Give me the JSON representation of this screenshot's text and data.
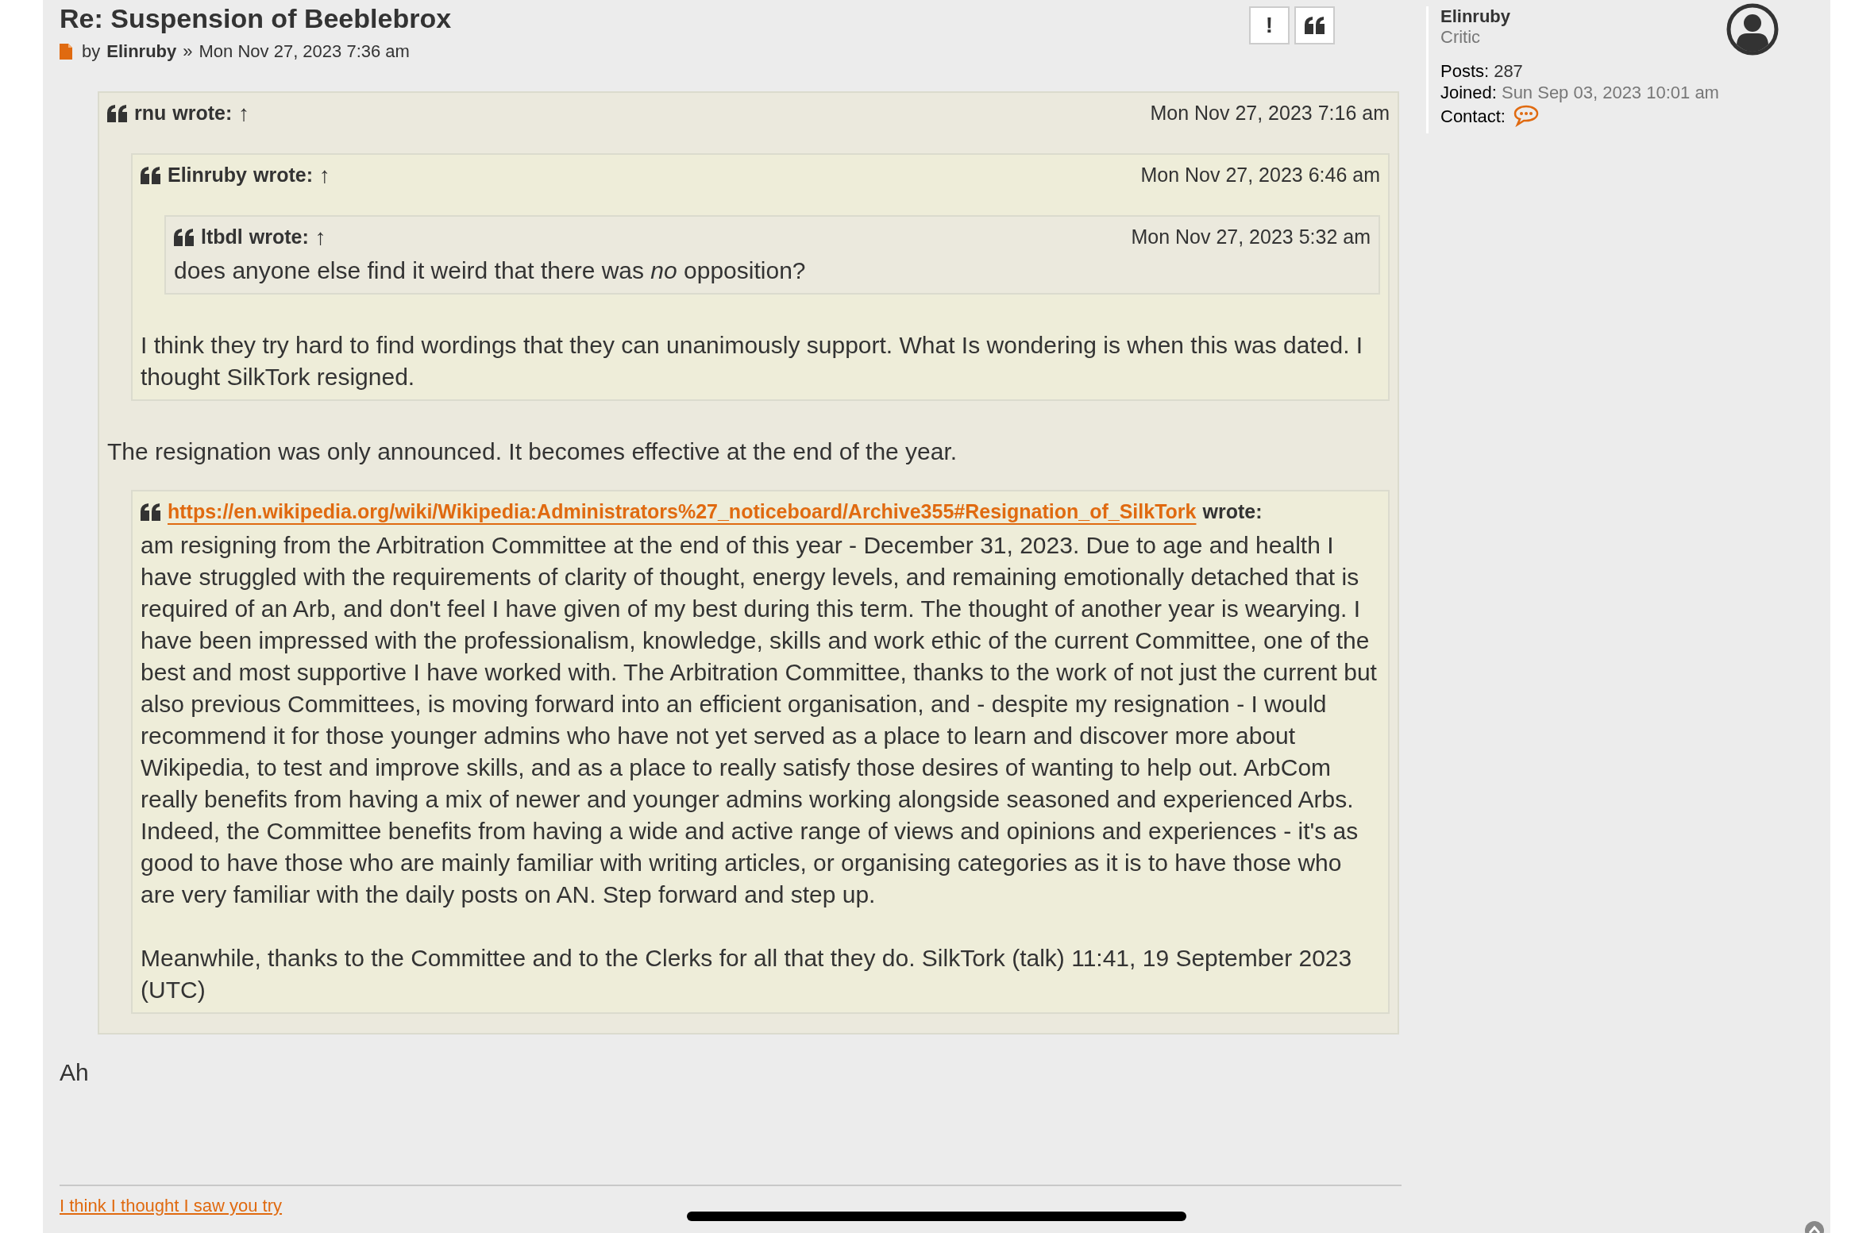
{
  "post": {
    "title": "Re: Suspension of Beeblebrox",
    "byline": {
      "prefix": "by",
      "author": "Elinruby",
      "separator": "»",
      "date": "Mon Nov 27, 2023 7:36 am"
    },
    "report_button": "!",
    "content": [
      {
        "kind": "quote",
        "cite": {
          "kind": "user",
          "text": "rnu"
        },
        "wrote": "wrote:",
        "arrow": "↑",
        "date": "Mon Nov 27, 2023 7:16 am",
        "children": [
          {
            "kind": "quote",
            "cite": {
              "kind": "user",
              "text": "Elinruby"
            },
            "wrote": "wrote:",
            "arrow": "↑",
            "date": "Mon Nov 27, 2023 6:46 am",
            "children": [
              {
                "kind": "quote",
                "cite": {
                  "kind": "user",
                  "text": "ltbdl"
                },
                "wrote": "wrote:",
                "arrow": "↑",
                "date": "Mon Nov 27, 2023 5:32 am",
                "children": [
                  {
                    "kind": "paragraph",
                    "text": "does anyone else find it weird that there was *no* opposition?"
                  }
                ]
              },
              {
                "kind": "paragraph",
                "text": "I think they try hard to find wordings that they can unanimously support. What Is wondering is when this was dated. I thought SilkTork resigned."
              }
            ]
          },
          {
            "kind": "paragraph",
            "text": "The resignation was only announced. It becomes effective at the end of the year."
          },
          {
            "kind": "quote",
            "cite": {
              "kind": "link",
              "text": "https://en.wikipedia.org/wiki/Wikipedia:Administrators%27_noticeboard/Archive355#Resignation_of_SilkTork"
            },
            "wrote": "wrote:",
            "children": [
              {
                "kind": "paragraph",
                "text": "am resigning from the Arbitration Committee at the end of this year - December 31, 2023. Due to age and health I have struggled with the requirements of clarity of thought, energy levels, and remaining emotionally detached that is required of an Arb, and don't feel I have given of my best during this term. The thought of another year is wearying. I have been impressed with the professionalism, knowledge, skills and work ethic of the current Committee, one of the best and most supportive I have worked with. The Arbitration Committee, thanks to the work of not just the current but also previous Committees, is moving forward into an efficient organisation, and - despite my resignation - I would recommend it for those younger admins who have not yet served as a place to learn and discover more about Wikipedia, to test and improve skills, and as a place to really satisfy those desires of wanting to help out. ArbCom really benefits from having a mix of newer and younger admins working alongside seasoned and experienced Arbs. Indeed, the Committee benefits from having a wide and active range of views and opinions and experiences - it's as good to have those who are mainly familiar with writing articles, or organising categories as it is to have those who are very familiar with the daily posts on AN. Step forward and step up."
              },
              {
                "kind": "paragraph",
                "text": "Meanwhile, thanks to the Committee and to the Clerks for all that they do. SilkTork (talk) 11:41, 19 September 2023 (UTC)"
              }
            ]
          }
        ]
      },
      {
        "kind": "paragraph",
        "text": "Ah"
      }
    ],
    "signature": "I think I thought I saw you try"
  },
  "profile": {
    "name": "Elinruby",
    "rank": "Critic",
    "posts_label": "Posts:",
    "posts": "287",
    "joined_label": "Joined:",
    "joined": "Sun Sep 03, 2023 10:01 am",
    "contact_label": "Contact:"
  }
}
